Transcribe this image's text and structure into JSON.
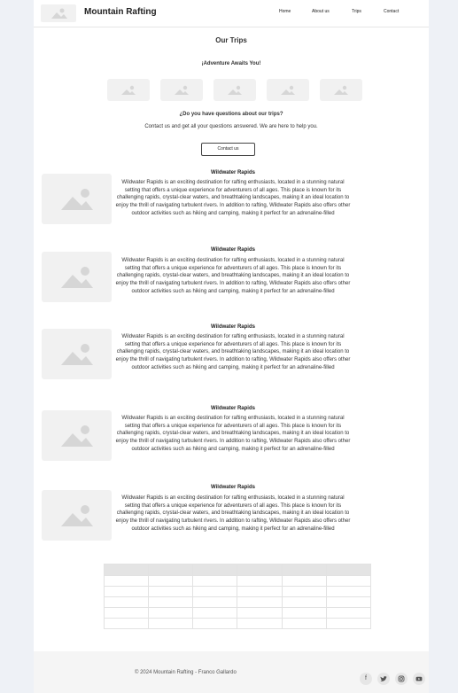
{
  "header": {
    "brand": "Mountain Rafting",
    "nav": [
      "Home",
      "About us",
      "Trips",
      "Contact"
    ]
  },
  "main": {
    "title": "Our Trips",
    "tagline": "¡Adventure Awaits You!",
    "question": "¿Do you have questions about our trips?",
    "contact_text": "Contact us and get all your questions answered. We are here to help you.",
    "contact_button": "Contact us"
  },
  "trips": [
    {
      "title": "Wildwater Rapids",
      "description": "Wildwater Rapids is an exciting destination for rafting enthusiasts, located in a stunning natural setting that offers a unique experience for adventurers of all ages. This place is known for its challenging rapids, crystal-clear waters, and breathtaking landscapes, making it an ideal location to enjoy the thrill of navigating turbulent rivers. In addition to rafting, Wildwater Rapids also offers other outdoor activities such as hiking and camping, making it perfect for an adrenaline-filled"
    },
    {
      "title": "Wildwater Rapids",
      "description": "Wildwater Rapids is an exciting destination for rafting enthusiasts, located in a stunning natural setting that offers a unique experience for adventurers of all ages. This place is known for its challenging rapids, crystal-clear waters, and breathtaking landscapes, making it an ideal location to enjoy the thrill of navigating turbulent rivers. In addition to rafting, Wildwater Rapids also offers other outdoor activities such as hiking and camping, making it perfect for an adrenaline-filled"
    },
    {
      "title": "Wildwater Rapids",
      "description": "Wildwater Rapids is an exciting destination for rafting enthusiasts, located in a stunning natural setting that offers a unique experience for adventurers of all ages. This place is known for its challenging rapids, crystal-clear waters, and breathtaking landscapes, making it an ideal location to enjoy the thrill of navigating turbulent rivers. In addition to rafting, Wildwater Rapids also offers other outdoor activities such as hiking and camping, making it perfect for an adrenaline-filled"
    },
    {
      "title": "Wildwater Rapids",
      "description": "Wildwater Rapids is an exciting destination for rafting enthusiasts, located in a stunning natural setting that offers a unique experience for adventurers of all ages. This place is known for its challenging rapids, crystal-clear waters, and breathtaking landscapes, making it an ideal location to enjoy the thrill of navigating turbulent rivers. In addition to rafting, Wildwater Rapids also offers other outdoor activities such as hiking and camping, making it perfect for an adrenaline-filled"
    },
    {
      "title": "Wildwater Rapids",
      "description": "Wildwater Rapids is an exciting destination for rafting enthusiasts, located in a stunning natural setting that offers a unique experience for adventurers of all ages. This place is known for its challenging rapids, crystal-clear waters, and breathtaking landscapes, making it an ideal location to enjoy the thrill of navigating turbulent rivers. In addition to rafting, Wildwater Rapids also offers other outdoor activities such as hiking and camping, making it perfect for an adrenaline-filled"
    }
  ],
  "footer": {
    "copyright": "© 2024 Mountain Rafting - Franco Gallardo",
    "social_icons": [
      "facebook-icon",
      "twitter-icon",
      "instagram-icon",
      "youtube-icon"
    ]
  },
  "colors": {
    "placeholder": "#f1f1f1",
    "placeholder_glyph": "#d6d6d6",
    "table_header": "#e4e4e4",
    "footer_bg": "#f5f5f5"
  }
}
